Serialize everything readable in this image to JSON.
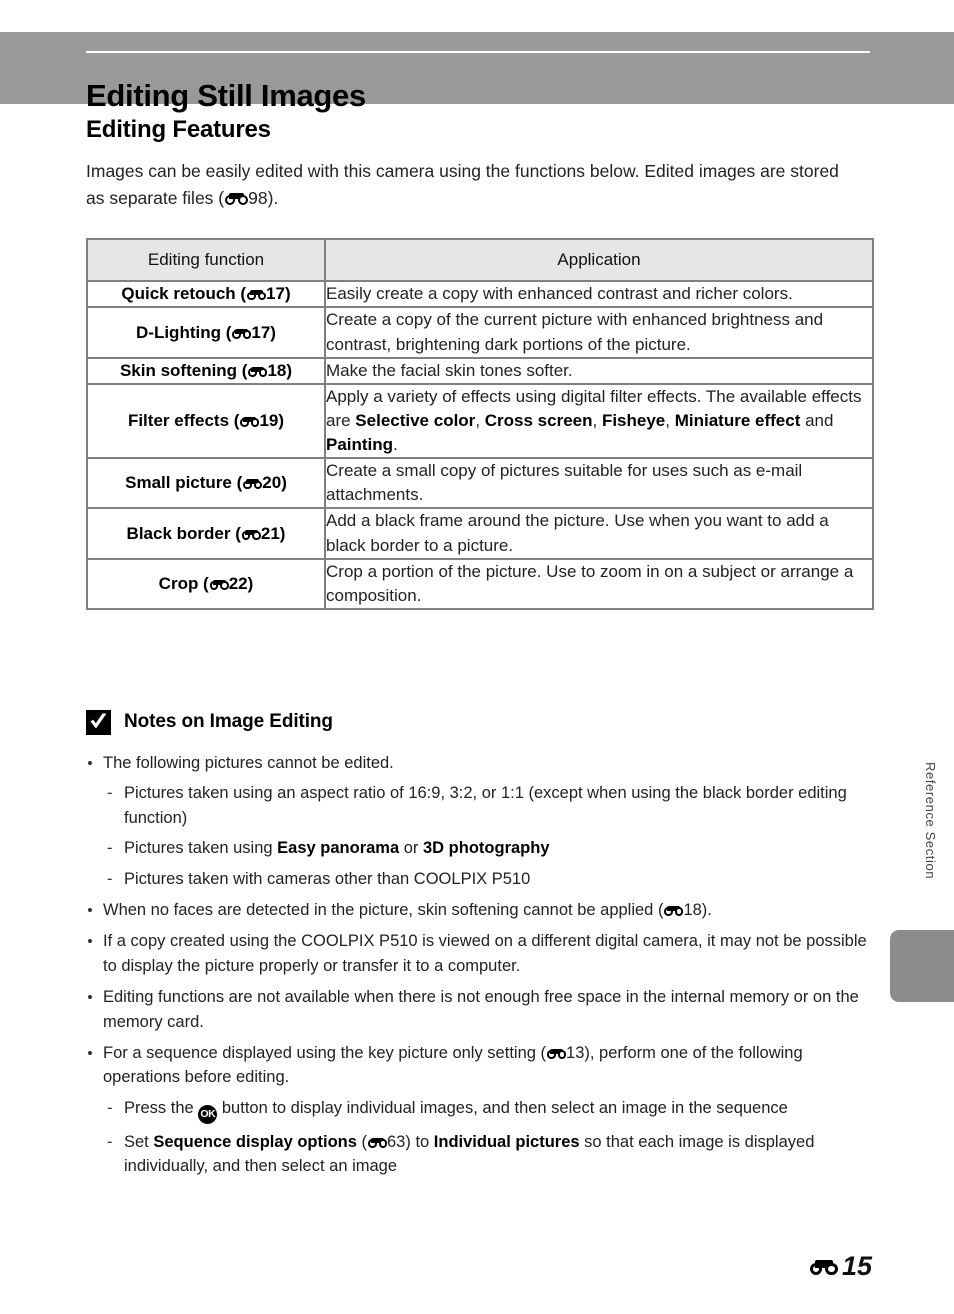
{
  "header": {
    "title": "Editing Still Images"
  },
  "side": {
    "vertical_label": "Reference Section"
  },
  "section": {
    "title": "Editing Features",
    "intro_1": "Images can be easily edited with this camera using the functions below. Edited images are stored as separate files (",
    "intro_ref": "98",
    "intro_2": ")."
  },
  "table": {
    "columns": [
      "Editing function",
      "Application"
    ],
    "rows": [
      {
        "function": "Quick retouch (",
        "ref": "17",
        "function_end": ")",
        "application": "Easily create a copy with enhanced contrast and richer colors."
      },
      {
        "function": "D-Lighting (",
        "ref": "17",
        "function_end": ")",
        "application": "Create a copy of the current picture with enhanced brightness and contrast, brightening dark portions of the picture."
      },
      {
        "function": "Skin softening (",
        "ref": "18",
        "function_end": ")",
        "application": "Make the facial skin tones softer."
      },
      {
        "function": "Filter effects (",
        "ref": "19",
        "function_end": ")",
        "application_a": "Apply a variety of effects using digital filter effects. The available effects are ",
        "application_b1": "Selective color",
        "application_sep1": ", ",
        "application_b2": "Cross screen",
        "application_sep2": ", ",
        "application_b3": "Fisheye",
        "application_sep3": ", ",
        "application_b4": "Miniature effect",
        "application_sep4": " and ",
        "application_b5": "Painting",
        "application_end": "."
      },
      {
        "function": "Small picture (",
        "ref": "20",
        "function_end": ")",
        "application": "Create a small copy of pictures suitable for uses such as e-mail attachments."
      },
      {
        "function": "Black border (",
        "ref": "21",
        "function_end": ")",
        "application": "Add a black frame around the picture. Use when you want to add a black border to a picture."
      },
      {
        "function": "Crop (",
        "ref": "22",
        "function_end": ")",
        "application": "Crop a portion of the picture. Use to zoom in on a subject or arrange a composition."
      }
    ]
  },
  "notes": {
    "icon": "caution-check-icon",
    "title": "Notes on Image Editing",
    "b1": "The following pictures cannot be edited.",
    "b1_s1": "Pictures taken using an aspect ratio of 16:9, 3:2, or 1:1 (except when using the black border editing function)",
    "b1_s2_a": "Pictures taken using ",
    "b1_s2_b1": "Easy panorama",
    "b1_s2_mid": " or ",
    "b1_s2_b2": "3D photography",
    "b1_s3": "Pictures taken with cameras other than COOLPIX P510",
    "b2_a": "When no faces are detected in the picture, skin softening cannot be applied (",
    "b2_ref": "18",
    "b2_end": ").",
    "b3": "If a copy created using the COOLPIX P510 is viewed on a different digital camera, it may not be possible to display the picture properly or transfer it to a computer.",
    "b4": "Editing functions are not available when there is not enough free space in the internal memory or on the memory card.",
    "b5_a": "For a sequence displayed using the key picture only setting (",
    "b5_ref": "13",
    "b5_b": "), perform one of the following operations before editing.",
    "b5_s1_a": "Press the ",
    "b5_s1_ok": "OK",
    "b5_s1_b": " button to display individual images, and then select an image in the sequence",
    "b5_s2_a": "Set ",
    "b5_s2_b1": "Sequence display options",
    "b5_s2_mid": " (",
    "b5_s2_ref": "63",
    "b5_s2_mid2": ") to ",
    "b5_s2_b2": "Individual pictures",
    "b5_s2_end": " so that each image is displayed individually, and then select an image"
  },
  "footer": {
    "page_number": "15"
  },
  "colors": {
    "header_band": "#999999",
    "side_tab": "#8c8c8c",
    "table_header_bg": "#e6e6e6",
    "table_border": "#808080"
  }
}
